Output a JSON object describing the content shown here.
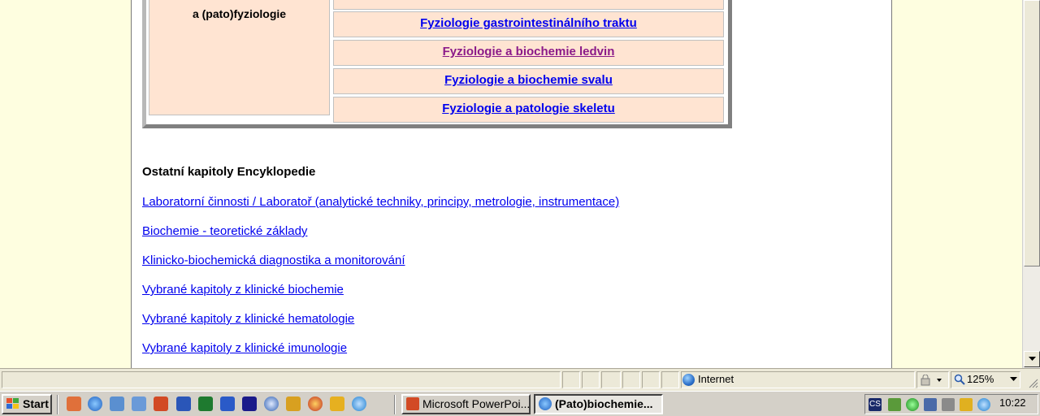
{
  "page": {
    "left_cell_text": "a (pato)fyziologie",
    "table_links": [
      {
        "label": "Fyziologie gastrointestinálního traktu",
        "visited": false
      },
      {
        "label": "Fyziologie a biochemie ledvin",
        "visited": true
      },
      {
        "label": "Fyziologie a biochemie svalu",
        "visited": false
      },
      {
        "label": "Fyziologie a patologie skeletu",
        "visited": false
      }
    ],
    "section_title": "Ostatní kapitoly Encyklopedie",
    "chapter_links": [
      "Laboratorní činnosti / Laboratoř (analytické techniky, principy, metrologie, instrumentace)",
      "Biochemie - teoretické základy",
      "Klinicko-biochemická diagnostika a monitorování",
      "Vybrané kapitoly z klinické biochemie",
      "Vybrané kapitoly z klinické hematologie",
      "Vybrané kapitoly z klinické imunologie"
    ]
  },
  "status_bar": {
    "zone": "Internet",
    "zoom": "125%"
  },
  "taskbar": {
    "start_label": "Start",
    "tasks": [
      {
        "label": "Microsoft PowerPoi...",
        "active": false,
        "icon": "powerpoint-icon"
      },
      {
        "label": "(Pato)biochemie...",
        "active": true,
        "icon": "internet-explorer-icon"
      }
    ],
    "tray_language": "CS",
    "clock": "10:22"
  },
  "colors": {
    "link": "#0000ee",
    "visited_link": "#8b1a89",
    "cell_background": "#ffe4d2",
    "page_background": "#fefee0"
  }
}
